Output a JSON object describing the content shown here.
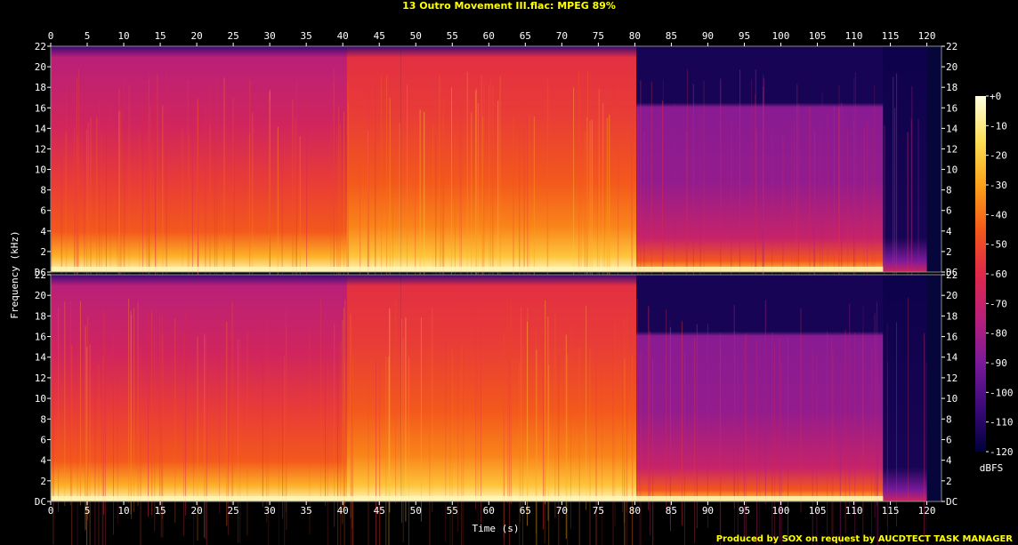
{
  "title": "13 Outro Movement III.flac: MPEG 89%",
  "credit": "Produced by SOX on request by AUCDTECT TASK MANAGER",
  "chart_data": {
    "type": "heatmap",
    "xlabel": "Time (s)",
    "ylabel": "Frequency (kHz)",
    "xlim": [
      0,
      122
    ],
    "x_ticks": [
      0,
      5,
      10,
      15,
      20,
      25,
      30,
      35,
      40,
      45,
      50,
      55,
      60,
      65,
      70,
      75,
      80,
      85,
      90,
      95,
      100,
      105,
      110,
      115,
      120
    ],
    "y_ticks": [
      "DC",
      "2",
      "4",
      "6",
      "8",
      "10",
      "12",
      "14",
      "16",
      "18",
      "20",
      "22"
    ],
    "y_tick_values": [
      0,
      2,
      4,
      6,
      8,
      10,
      12,
      14,
      16,
      18,
      20,
      22
    ],
    "channels": 2,
    "colorbar": {
      "label": "dBFS",
      "ticks": [
        "+0",
        "-10",
        "-20",
        "-30",
        "-40",
        "-50",
        "-60",
        "-70",
        "-80",
        "-90",
        "-100",
        "-110",
        "-120"
      ],
      "tick_values": [
        0,
        -10,
        -20,
        -30,
        -40,
        -50,
        -60,
        -70,
        -80,
        -90,
        -100,
        -110,
        -120
      ],
      "range": [
        -120,
        0
      ]
    },
    "segments": [
      {
        "start": 0,
        "end": 40.5,
        "top_khz": 18.8,
        "level": "mid"
      },
      {
        "start": 40.5,
        "end": 48,
        "top_khz": 20,
        "level": "high"
      },
      {
        "start": 48,
        "end": 80.2,
        "top_khz": 19.5,
        "level": "high"
      },
      {
        "start": 80.2,
        "end": 114,
        "top_khz": 16,
        "level": "decaying"
      },
      {
        "start": 114,
        "end": 120,
        "top_khz": 3,
        "level": "fadeout"
      }
    ],
    "grid": false,
    "colormap": [
      "#00003c",
      "#3b0a7a",
      "#7a1a9a",
      "#b8207a",
      "#e0284a",
      "#f45a1a",
      "#fca21a",
      "#fde056",
      "#ffffe0"
    ]
  }
}
